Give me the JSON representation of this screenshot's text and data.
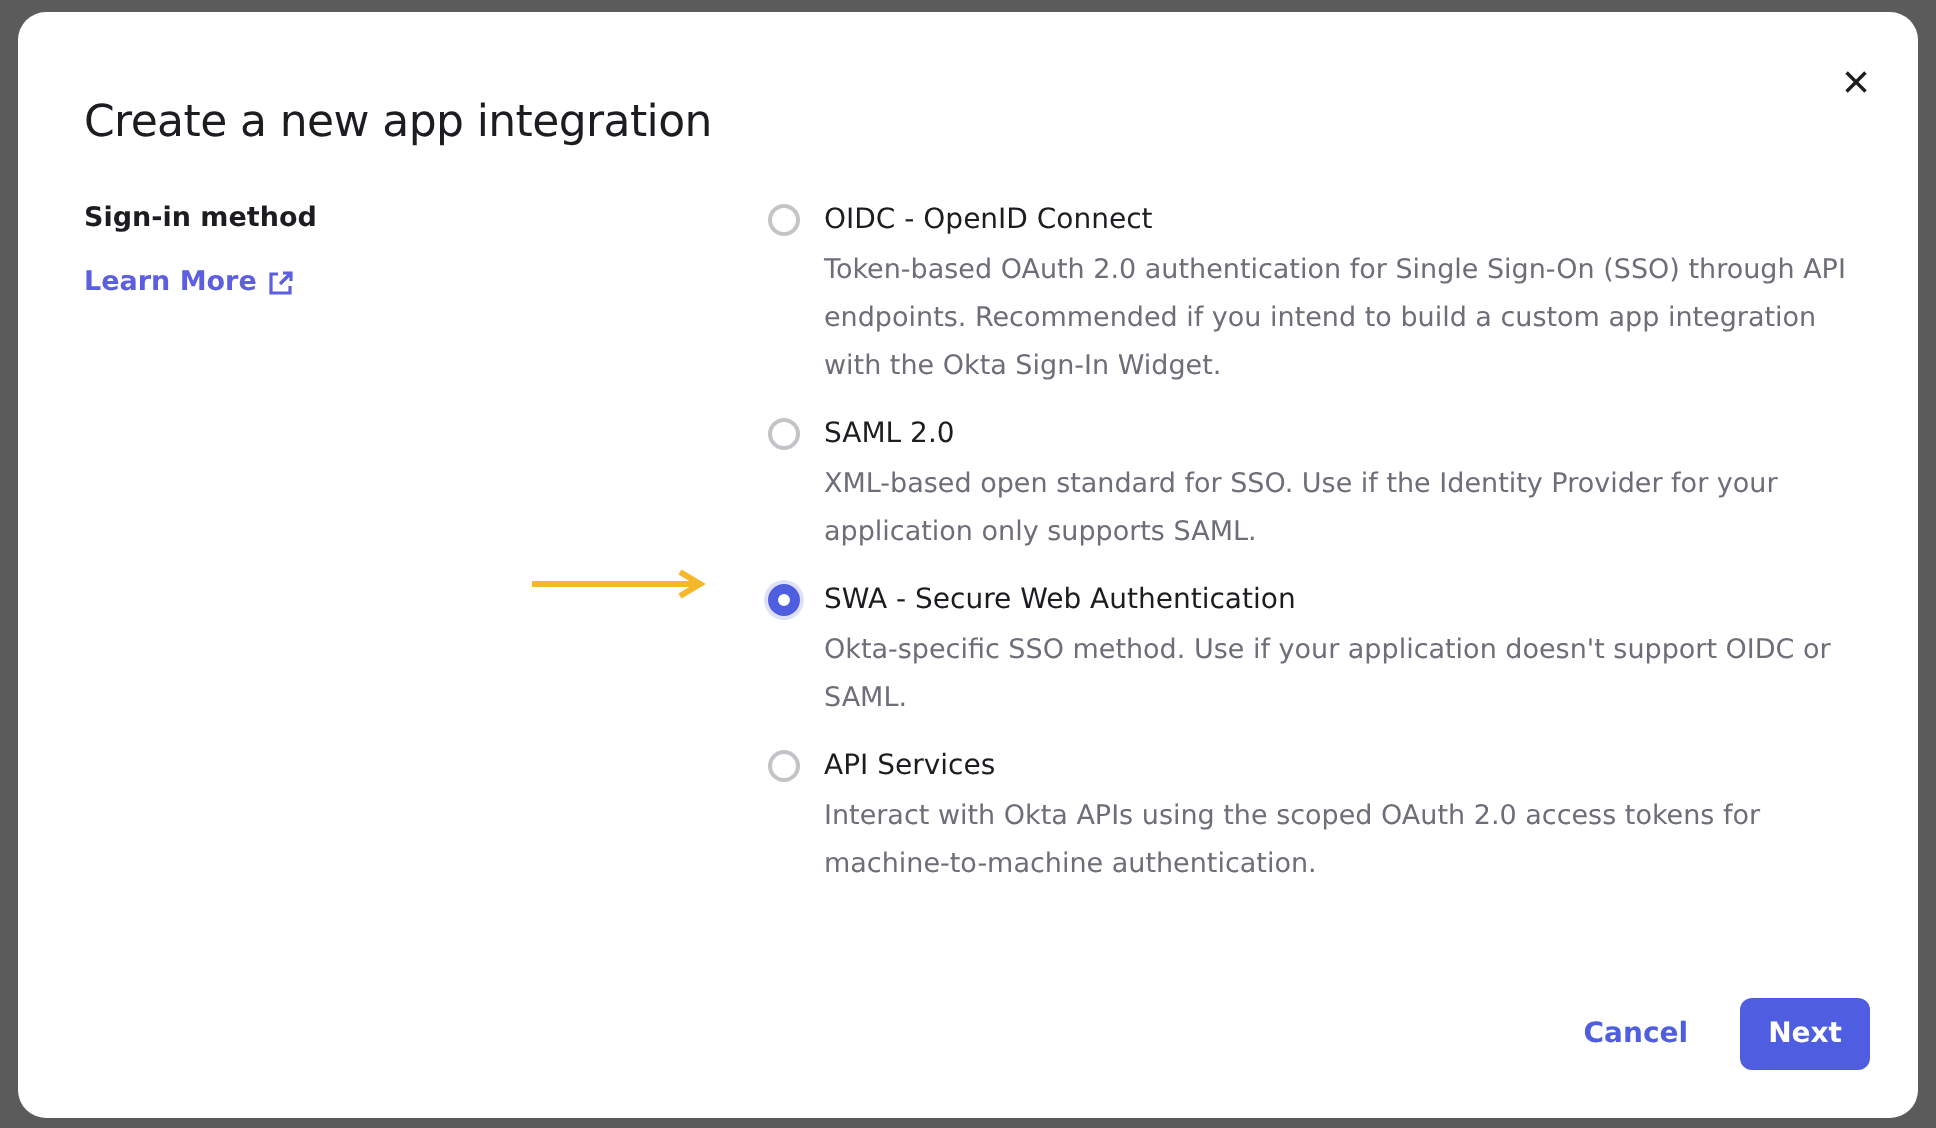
{
  "dialog": {
    "title": "Create a new app integration",
    "close_icon": "×",
    "field_label": "Sign-in method",
    "learn_more": "Learn More",
    "options": [
      {
        "label": "OIDC - OpenID Connect",
        "description": "Token-based OAuth 2.0 authentication for Single Sign-On (SSO) through API endpoints. Recommended if you intend to build a custom app integration with the Okta Sign-In Widget.",
        "selected": false,
        "pointed": false
      },
      {
        "label": "SAML 2.0",
        "description": "XML-based open standard for SSO. Use if the Identity Provider for your application only supports SAML.",
        "selected": false,
        "pointed": false
      },
      {
        "label": "SWA - Secure Web Authentication",
        "description": "Okta-specific SSO method. Use if your application doesn't support OIDC or SAML.",
        "selected": true,
        "pointed": true
      },
      {
        "label": "API Services",
        "description": "Interact with Okta APIs using the scoped OAuth 2.0 access tokens for machine-to-machine authentication.",
        "selected": false,
        "pointed": false
      }
    ],
    "buttons": [
      {
        "label": "Cancel",
        "kind": "secondary"
      },
      {
        "label": "Next",
        "kind": "primary"
      }
    ]
  }
}
